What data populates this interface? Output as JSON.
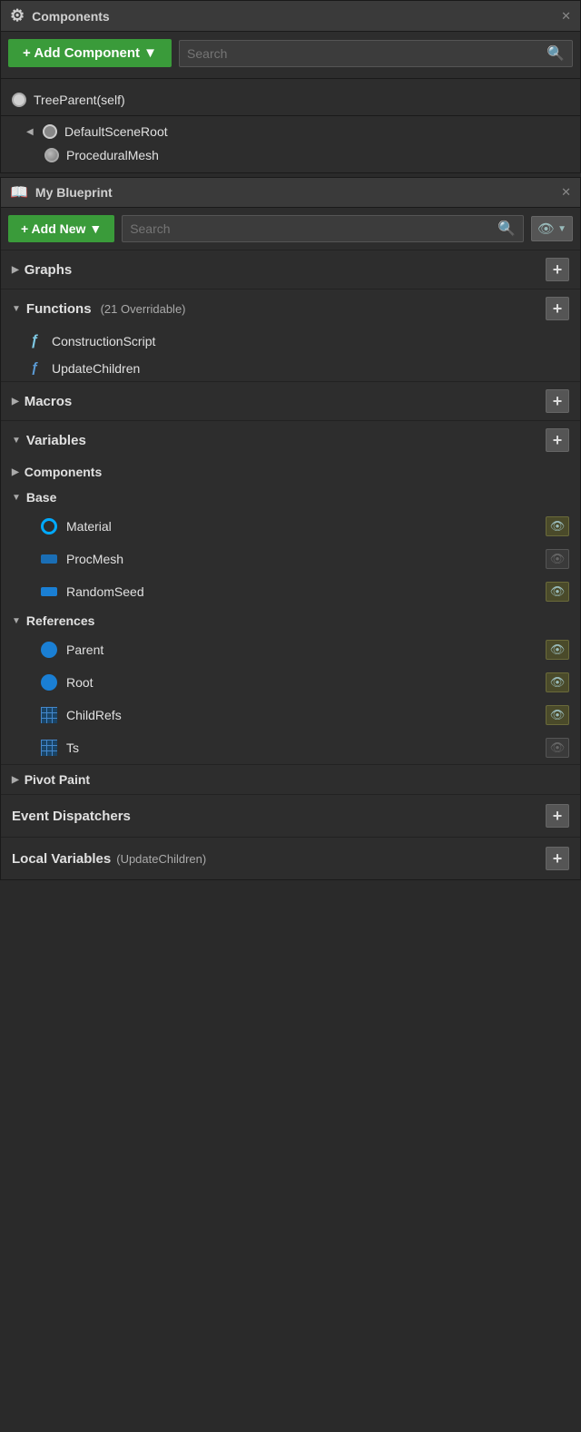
{
  "components_panel": {
    "title": "Components",
    "add_component_label": "+ Add Component ▼",
    "search_placeholder": "Search",
    "tree_items": [
      {
        "label": "TreeParent(self)",
        "type": "root",
        "indent": 0,
        "has_arrow": false
      },
      {
        "label": "DefaultSceneRoot",
        "type": "scene",
        "indent": 1,
        "has_arrow": true
      },
      {
        "label": "ProceduralMesh",
        "type": "mesh",
        "indent": 2,
        "has_arrow": false
      }
    ]
  },
  "blueprint_panel": {
    "title": "My Blueprint",
    "add_new_label": "+ Add New ▼",
    "search_placeholder": "Search",
    "sections": [
      {
        "label": "Graphs",
        "has_arrow": false,
        "has_plus": true
      },
      {
        "label": "Functions",
        "sub_label": "(21 Overridable)",
        "has_arrow": true,
        "has_plus": true
      },
      {
        "label": "Macros",
        "has_arrow": false,
        "has_plus": true
      },
      {
        "label": "Variables",
        "has_arrow": true,
        "has_plus": true
      },
      {
        "label": "Event Dispatchers",
        "has_plus": true
      },
      {
        "label": "Local Variables",
        "sub_label": "(UpdateChildren)",
        "has_plus": true
      }
    ],
    "functions": [
      {
        "label": "ConstructionScript",
        "special": true
      },
      {
        "label": "UpdateChildren",
        "special": false
      }
    ],
    "variable_groups": [
      {
        "label": "Components",
        "arrow": false
      },
      {
        "label": "Base",
        "arrow": true
      }
    ],
    "variables_base": [
      {
        "label": "Material",
        "icon": "ring",
        "eye": true
      },
      {
        "label": "ProcMesh",
        "icon": "blue-rect",
        "eye": false
      },
      {
        "label": "RandomSeed",
        "icon": "blue-rect",
        "eye": true
      }
    ],
    "references_label": "References",
    "variables_refs": [
      {
        "label": "Parent",
        "icon": "blue-solid",
        "eye": true
      },
      {
        "label": "Root",
        "icon": "blue-solid",
        "eye": true
      },
      {
        "label": "ChildRefs",
        "icon": "grid",
        "eye": true
      },
      {
        "label": "Ts",
        "icon": "grid",
        "eye": false
      }
    ],
    "pivot_paint_label": "Pivot Paint"
  }
}
